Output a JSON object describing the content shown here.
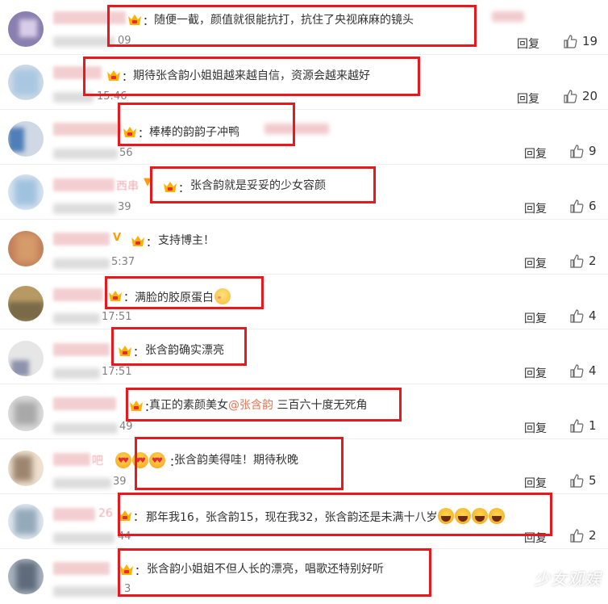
{
  "labels": {
    "reply": "回复",
    "colon": "："
  },
  "watermark": "少女观娱",
  "comments": [
    {
      "text": "随便一截，颜值就很能抗打，抗住了央视麻麻的镜头",
      "time": "09",
      "likes": "19",
      "avatar_colors": [
        "#8a7fb0",
        "#b8a9d6",
        "#d8cde8"
      ]
    },
    {
      "text": "期待张含韵小姐姐越来越自信，资源会越来越好",
      "time": "15:46",
      "likes": "20",
      "avatar_colors": [
        "#a9c7e0",
        "#cfdce8",
        "#e6eef5"
      ]
    },
    {
      "text": "棒棒的韵韵子冲鸭",
      "time": "56",
      "likes": "9",
      "avatar_colors": [
        "#4f7eb8",
        "#cfd8e4",
        "#9ab3cf"
      ]
    },
    {
      "name_suffix": "西串",
      "text": "张含韵就是妥妥的少女容颜",
      "time": "39",
      "likes": "6",
      "avatar_colors": [
        "#9fc2de",
        "#d5e3ef",
        "#bcd2e6"
      ]
    },
    {
      "text": "支持博主！",
      "time": "5:37",
      "likes": "2",
      "avatar_colors": [
        "#a8744f",
        "#d69b6a",
        "#c4825c"
      ]
    },
    {
      "text": "满脸的胶原蛋白",
      "time": "17:51",
      "likes": "4",
      "avatar_colors": [
        "#7a6a48",
        "#b79a63",
        "#d9c089"
      ]
    },
    {
      "text": "张含韵确实漂亮",
      "time": "17:51",
      "likes": "4",
      "avatar_colors": [
        "#c9c9c9",
        "#e6e6e6",
        "#8d92ad"
      ]
    },
    {
      "text_before": "真正的素颜美女",
      "mention": "@张含韵",
      "text_after": " 三百六十度无死角",
      "time": "49",
      "likes": "1",
      "avatar_colors": [
        "#c2c2c2",
        "#dadada",
        "#a8a8a8"
      ]
    },
    {
      "name_suffix": "吧",
      "text": "张含韵美得哇！期待秋晚",
      "time": "39",
      "likes": "5",
      "avatar_colors": [
        "#d1b59a",
        "#efe0cf",
        "#9c8570"
      ]
    },
    {
      "name_suffix": "26",
      "text": "那年我16，张含韵15，现在我32，张含韵还是未满十八岁",
      "time": "44",
      "likes": "2",
      "avatar_colors": [
        "#b8cad8",
        "#dfe8ef",
        "#94a9ba"
      ]
    },
    {
      "text": "张含韵小姐姐不但人长的漂亮，唱歌还特别好听",
      "time": "3",
      "likes": "",
      "avatar_colors": [
        "#5f6b7a",
        "#a9b3c0",
        "#d2d8df"
      ]
    }
  ]
}
